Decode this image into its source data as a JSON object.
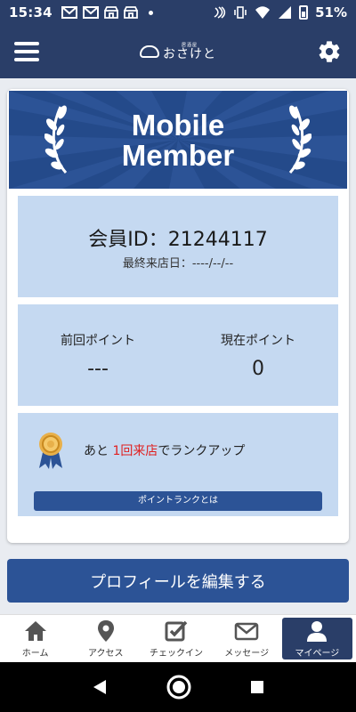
{
  "status_bar": {
    "time": "15:34",
    "battery_percent": "51%",
    "icons": [
      "gmail-icon",
      "gmail-icon",
      "store-icon",
      "store-icon",
      "notification-dot",
      "nfc-icon",
      "vibrate-icon",
      "wifi-icon",
      "signal-icon",
      "battery-icon"
    ]
  },
  "header": {
    "logo_sub": "居酒屋",
    "logo_main": "おさけと",
    "menu_icon": "hamburger-icon",
    "settings_icon": "gear-icon"
  },
  "card": {
    "banner_line1": "Mobile",
    "banner_line2": "Member",
    "member_id": "会員ID：21244117",
    "last_visit": "最終来店日：----/--/--",
    "previous_points_label": "前回ポイント",
    "previous_points_value": "---",
    "current_points_label": "現在ポイント",
    "current_points_value": "0",
    "rank_prefix": "あと ",
    "rank_highlight": "1回来店",
    "rank_suffix": "でランクアップ",
    "rank_button": "ポイントランクとは"
  },
  "edit_profile_button": "プロフィールを編集する",
  "bottom_nav": {
    "items": [
      {
        "label": "ホーム",
        "icon": "home-icon"
      },
      {
        "label": "アクセス",
        "icon": "map-pin-icon"
      },
      {
        "label": "チェックイン",
        "icon": "checkbox-icon"
      },
      {
        "label": "メッセージ",
        "icon": "envelope-icon"
      },
      {
        "label": "マイページ",
        "icon": "user-icon",
        "active": true
      }
    ]
  },
  "colors": {
    "header": "#2a3e68",
    "accent": "#2c5396",
    "panel": "#c5d9f1",
    "highlight": "#e02020"
  }
}
